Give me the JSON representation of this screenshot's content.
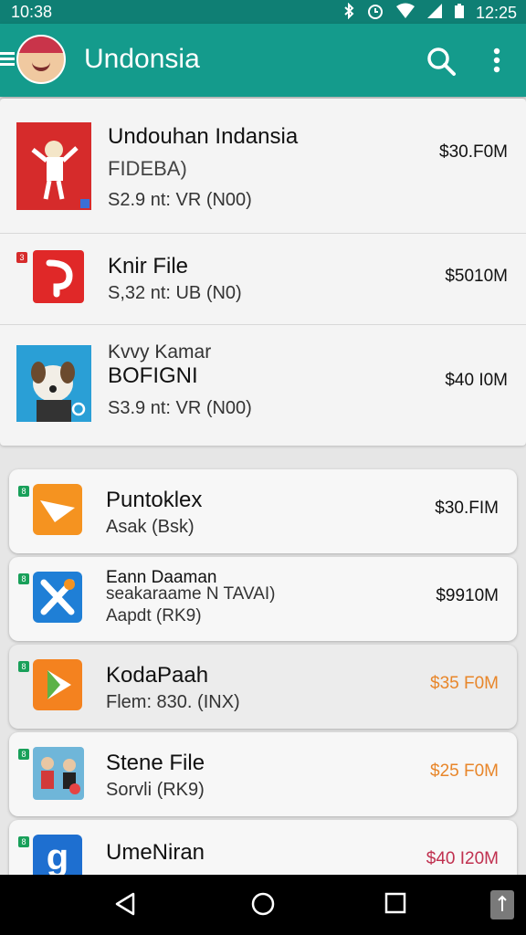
{
  "status": {
    "time_left": "10:38",
    "time_right": "12:25"
  },
  "header": {
    "title": "Undonsia"
  },
  "top_list": [
    {
      "name": "Undouhan Indansia",
      "line2": "FIDEBA)",
      "meta": "S2.9 nt: VR (N00)",
      "price": "$30.F0M",
      "icon": "red-character-icon"
    },
    {
      "name": "Knir File",
      "meta": "S,32 nt: UB (N0)",
      "price": "$5010M",
      "icon": "red-play-icon"
    },
    {
      "pre": "Kvvy Kamar",
      "name": "BOFIGNI",
      "meta": "S3.9 nt: VR (N00)",
      "price": "$40 I0M",
      "icon": "dog-photo-icon"
    }
  ],
  "cards": [
    {
      "name": "Puntoklex",
      "meta": "Asak (Bsk)",
      "price": "$30.FIM",
      "icon": "orange-paper-icon",
      "price_color": "#111111"
    },
    {
      "name": "Eann Daaman",
      "line2": "seakaraame N TAVAI)",
      "meta": "Aapdt (RK9)",
      "price": "$9910M",
      "icon": "blue-tools-icon",
      "price_color": "#111111"
    },
    {
      "name": "KodaPaah",
      "meta": "Flem: 830. (INX)",
      "price": "$35 F0M",
      "icon": "orange-play-icon",
      "price_color": "#e8862a"
    },
    {
      "name": "Stene File",
      "meta": "Sorvli (RK9)",
      "price": "$25 F0M",
      "icon": "kids-photo-icon",
      "price_color": "#e8862a"
    },
    {
      "name": "UmeNiran",
      "meta": "",
      "price": "$40 I20M",
      "icon": "blue-g-icon",
      "price_color": "#c0304f"
    }
  ],
  "colors": {
    "appbar": "#149b8c",
    "statusbar": "#0f7f74",
    "accent_orange": "#e8862a"
  }
}
